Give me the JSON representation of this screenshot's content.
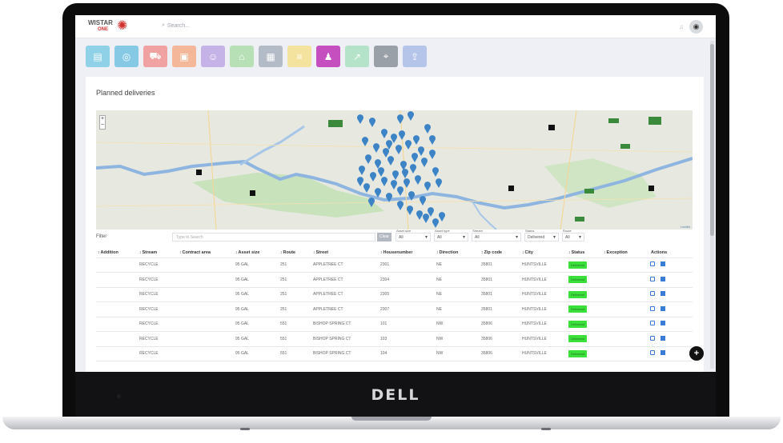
{
  "device": {
    "brand": "DELL"
  },
  "header": {
    "logo_text": "WISTAR",
    "logo_sub": "ONE",
    "search_placeholder": "Search..."
  },
  "tiles": [
    {
      "icon": "clipboard-icon",
      "color": "#8fd1e6"
    },
    {
      "icon": "asset-counter-icon",
      "color": "#86c9e4"
    },
    {
      "icon": "truck-icon",
      "color": "#f0a1a1"
    },
    {
      "icon": "invoice-icon",
      "color": "#f4b79a"
    },
    {
      "icon": "people-icon",
      "color": "#c5b3e8"
    },
    {
      "icon": "house-icon",
      "color": "#b7e0b7"
    },
    {
      "icon": "building-icon",
      "color": "#b3bcc6"
    },
    {
      "icon": "document-icon",
      "color": "#f4e39e"
    },
    {
      "icon": "route-person-icon",
      "color": "#c54fbf"
    },
    {
      "icon": "chart-icon",
      "color": "#b4e3c9"
    },
    {
      "icon": "location-pin-icon",
      "color": "#9aa0a8"
    },
    {
      "icon": "export-icon",
      "color": "#b5c5ea"
    }
  ],
  "page": {
    "title": "Planned deliveries",
    "map_attribution": "Leaflet"
  },
  "filters": {
    "label": "Filter",
    "search_placeholder": "Type to Search",
    "clear_label": "Clear",
    "asset_size": {
      "label": "Asset size",
      "value": "All"
    },
    "asset_type": {
      "label": "Asset type",
      "value": "All"
    },
    "stream": {
      "label": "Stream",
      "value": "All"
    },
    "status": {
      "label": "Status",
      "value": "Delivered"
    },
    "route": {
      "label": "Route",
      "value": "All"
    }
  },
  "table": {
    "columns": [
      "Addition",
      "Stream",
      "Contract area",
      "Asset size",
      "Route",
      "Street",
      "Housenumber",
      "Direction",
      "Zip code",
      "City",
      "Status",
      "Exception",
      "Actions"
    ],
    "rows": [
      {
        "addition": "",
        "stream": "RECYCLE",
        "contract_area": "",
        "asset_size": "95 GAL",
        "route": "251",
        "street": "APPLETREE CT",
        "housenumber": "2301",
        "direction": "NE",
        "zip": "35801",
        "city": "HUNTSVILLE",
        "status": "Delivered",
        "exception": ""
      },
      {
        "addition": "",
        "stream": "RECYCLE",
        "contract_area": "",
        "asset_size": "95 GAL",
        "route": "251",
        "street": "APPLETREE CT",
        "housenumber": "2304",
        "direction": "NE",
        "zip": "35801",
        "city": "HUNTSVILLE",
        "status": "Delivered",
        "exception": ""
      },
      {
        "addition": "",
        "stream": "RECYCLE",
        "contract_area": "",
        "asset_size": "95 GAL",
        "route": "251",
        "street": "APPLETREE CT",
        "housenumber": "2305",
        "direction": "NE",
        "zip": "35801",
        "city": "HUNTSVILLE",
        "status": "Delivered",
        "exception": ""
      },
      {
        "addition": "",
        "stream": "RECYCLE",
        "contract_area": "",
        "asset_size": "95 GAL",
        "route": "251",
        "street": "APPLETREE CT",
        "housenumber": "2307",
        "direction": "NE",
        "zip": "35801",
        "city": "HUNTSVILLE",
        "status": "Delivered",
        "exception": ""
      },
      {
        "addition": "",
        "stream": "RECYCLE",
        "contract_area": "",
        "asset_size": "95 GAL",
        "route": "551",
        "street": "BISHOP SPRING CT",
        "housenumber": "101",
        "direction": "NW",
        "zip": "35806",
        "city": "HUNTSVILLE",
        "status": "Delivered",
        "exception": ""
      },
      {
        "addition": "",
        "stream": "RECYCLE",
        "contract_area": "",
        "asset_size": "95 GAL",
        "route": "551",
        "street": "BISHOP SPRING CT",
        "housenumber": "103",
        "direction": "NW",
        "zip": "35806",
        "city": "HUNTSVILLE",
        "status": "Delivered",
        "exception": ""
      },
      {
        "addition": "",
        "stream": "RECYCLE",
        "contract_area": "",
        "asset_size": "95 GAL",
        "route": "551",
        "street": "BISHOP SPRING CT",
        "housenumber": "104",
        "direction": "NW",
        "zip": "35806",
        "city": "HUNTSVILLE",
        "status": "Delivered",
        "exception": ""
      }
    ]
  }
}
